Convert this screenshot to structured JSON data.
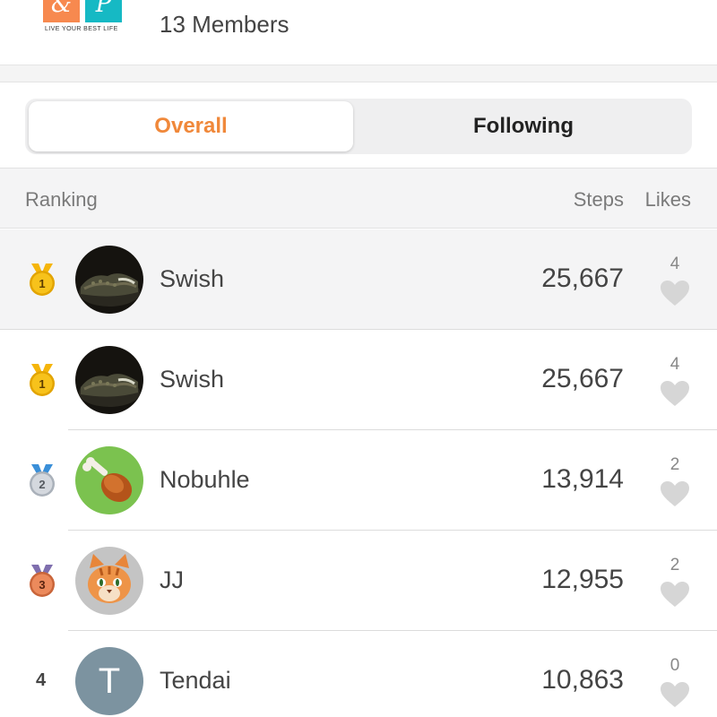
{
  "header": {
    "logo_left_glyph": "&",
    "logo_right_glyph": "P",
    "logo_tagline": "LIVE YOUR BEST LIFE",
    "members_label": "13 Members"
  },
  "segment": {
    "overall_label": "Overall",
    "following_label": "Following",
    "active": "overall"
  },
  "columns": {
    "ranking": "Ranking",
    "steps": "Steps",
    "likes": "Likes"
  },
  "colors": {
    "accent": "#f0883a",
    "gold": "#f5b50a",
    "silver": "#c8ccd2",
    "bronze": "#e07850",
    "heart": "#d6d6d6"
  },
  "rows": [
    {
      "rank": "1",
      "medal": "gold",
      "avatar": "sneakers-avatar",
      "name": "Swish",
      "steps": "25,667",
      "likes": "4",
      "highlight": true
    },
    {
      "rank": "1",
      "medal": "gold",
      "avatar": "sneakers-avatar",
      "name": "Swish",
      "steps": "25,667",
      "likes": "4",
      "highlight": false
    },
    {
      "rank": "2",
      "medal": "silver",
      "avatar": "drumstick-avatar",
      "name": "Nobuhle",
      "steps": "13,914",
      "likes": "2",
      "highlight": false
    },
    {
      "rank": "3",
      "medal": "bronze",
      "avatar": "cat-avatar",
      "name": "JJ",
      "steps": "12,955",
      "likes": "2",
      "highlight": false
    },
    {
      "rank": "4",
      "medal": "none",
      "avatar": "initial-avatar",
      "initial": "T",
      "name": "Tendai",
      "steps": "10,863",
      "likes": "0",
      "highlight": false
    }
  ]
}
